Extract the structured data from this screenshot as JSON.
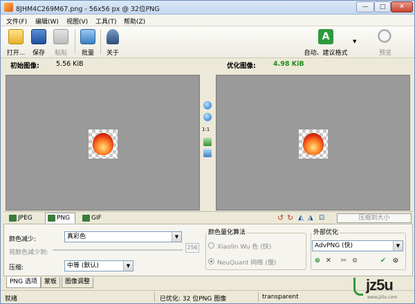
{
  "window": {
    "title": "8JHM4C269M67.png - 56x56 px @ 32位PNG",
    "controls": {
      "minimize": "—",
      "maximize": "□",
      "close": "✕"
    }
  },
  "menu": [
    "文件(F)",
    "编辑(W)",
    "视图(V)",
    "工具(T)",
    "帮助(Z)"
  ],
  "toolbar": {
    "open": "打开...",
    "save": "保存",
    "paste": "粘贴",
    "batch": "批量",
    "about": "关于",
    "auto_suggest": "自动、建议格式",
    "auto_letter": "A",
    "preview": "预览"
  },
  "header": {
    "original_label": "初始图像:",
    "original_size": "5.56 KiB",
    "optimized_label": "优化图像:",
    "optimized_size": "4.98 KiB"
  },
  "zoom": {
    "ratio": "1:1"
  },
  "format_tabs": [
    "JPEG",
    "PNG",
    "GIF"
  ],
  "compress_to_size": "压缩到大小",
  "options": {
    "color_reduction_label": "颜色减少:",
    "color_reduction_value": "真彩色",
    "reduce_colors_to_label": "将颜色减少到:",
    "reduce_colors_value": "256",
    "compression_label": "压缩:",
    "compression_value": "中等 (默认)",
    "quant_group_title": "颜色量化算法",
    "quant_opt1": "Xiaolin Wu 色 (快)",
    "quant_opt2": "NeuQuant 网络 (慢)",
    "external_group_title": "外部优化",
    "external_value": "AdvPNG (快)"
  },
  "bottom_tabs": [
    "PNG 选项",
    "蒙板",
    "图像调整"
  ],
  "status": {
    "left": "就绪",
    "middle": "已优化: 32 位PNG 图像",
    "right": "transparent"
  },
  "watermark": {
    "text": "jz5u",
    "subtext": "www.jz5u.com"
  },
  "colors": {
    "pane_bg": "#9a9a9a",
    "optimized_size": "#1f8c1f",
    "accent_green": "#2e9a3e"
  }
}
